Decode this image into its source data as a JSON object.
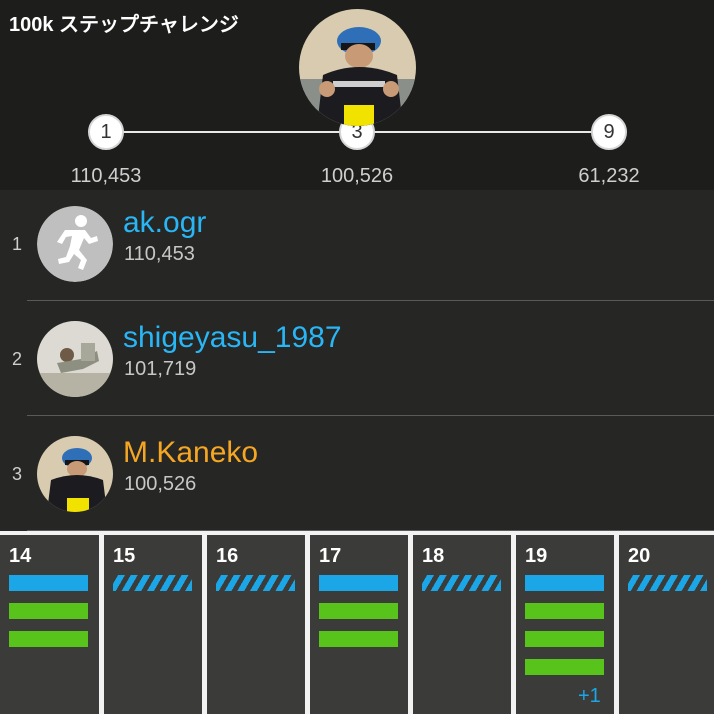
{
  "challenge": {
    "title": "100k ステップチャレンジ",
    "nodes": [
      {
        "rank": "1",
        "steps": "110,453"
      },
      {
        "rank": "3",
        "steps": "100,526"
      },
      {
        "rank": "9",
        "steps": "61,232"
      }
    ]
  },
  "leaderboard": [
    {
      "rank": "1",
      "name": "ak.ogr",
      "steps": "110,453",
      "name_color": "#29b6f6",
      "avatar": "runner-icon"
    },
    {
      "rank": "2",
      "name": "shigeyasu_1987",
      "steps": "101,719",
      "name_color": "#29b6f6",
      "avatar": "user-photo"
    },
    {
      "rank": "3",
      "name": "M.Kaneko",
      "steps": "100,526",
      "name_color": "#f5a623",
      "avatar": "cyclist-photo"
    }
  ],
  "calendar": {
    "days": [
      {
        "day": "14",
        "bars": [
          "blue",
          "green",
          "green"
        ]
      },
      {
        "day": "15",
        "bars": [
          "striped"
        ]
      },
      {
        "day": "16",
        "bars": [
          "striped"
        ]
      },
      {
        "day": "17",
        "bars": [
          "blue",
          "green",
          "green"
        ]
      },
      {
        "day": "18",
        "bars": [
          "striped"
        ]
      },
      {
        "day": "19",
        "bars": [
          "blue",
          "green",
          "green",
          "green"
        ],
        "extra": "+1"
      },
      {
        "day": "20",
        "bars": [
          "striped"
        ]
      }
    ]
  },
  "colors": {
    "accent_blue": "#1ba6e8",
    "goal_green": "#58c31a",
    "highlight_orange": "#f5a623"
  }
}
